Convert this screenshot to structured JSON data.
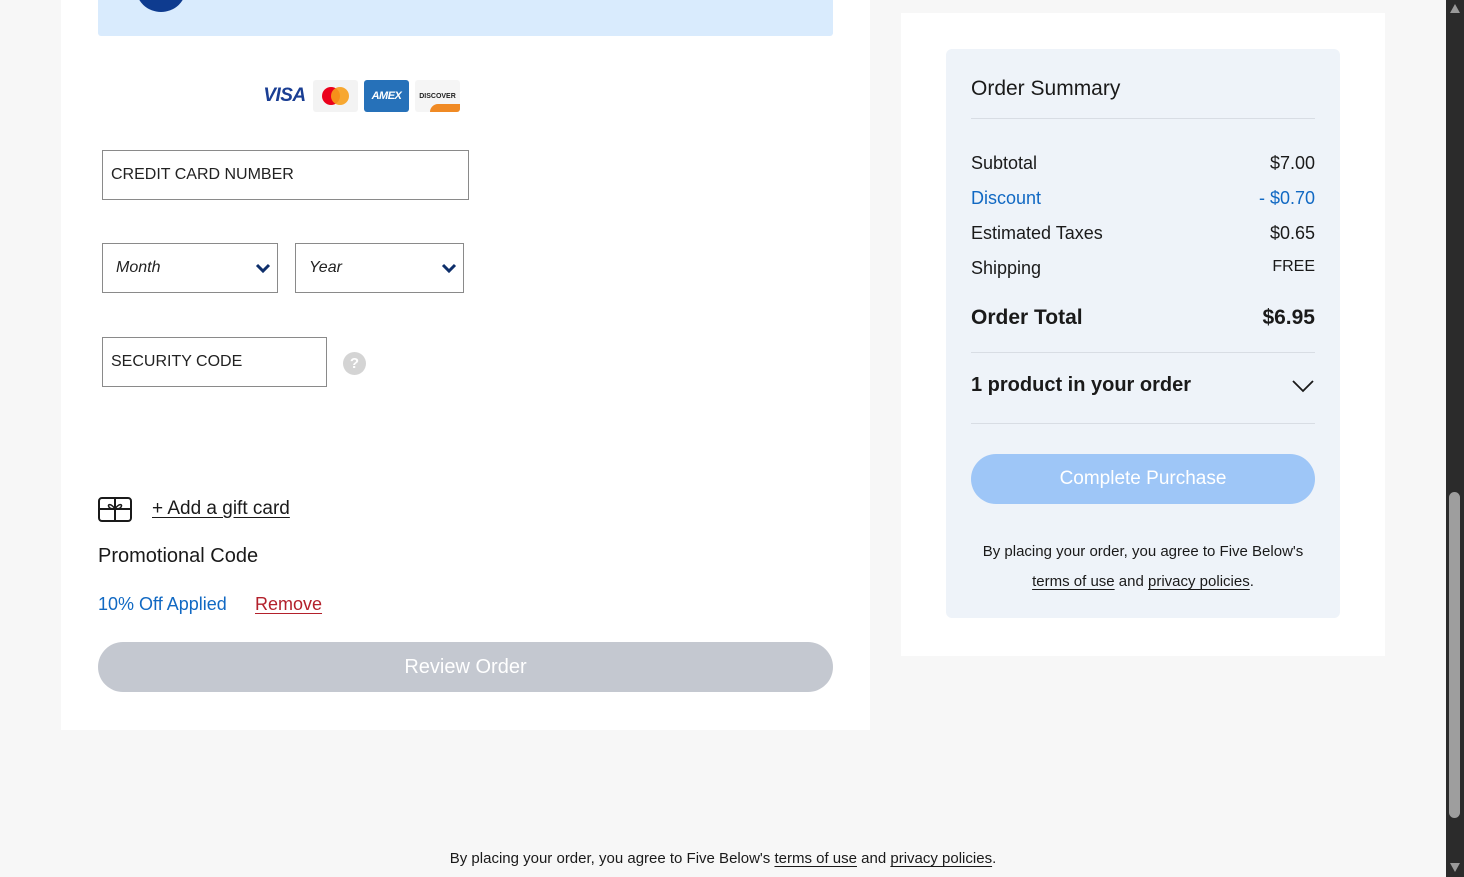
{
  "payment": {
    "card_logos": [
      "VISA",
      "AMEX",
      "DISCOVER"
    ],
    "card_number_placeholder": "CREDIT CARD NUMBER",
    "month_placeholder": "Month",
    "year_placeholder": "Year",
    "security_code_placeholder": "SECURITY CODE",
    "help_glyph": "?"
  },
  "gift_card": {
    "link_label": "+ Add a gift card",
    "icon": "gift-card-icon"
  },
  "promo": {
    "title": "Promotional Code",
    "applied_text": "10% Off Applied",
    "remove_label": "Remove"
  },
  "review_button_label": "Review Order",
  "summary": {
    "title": "Order Summary",
    "subtotal_label": "Subtotal",
    "subtotal_value": "$7.00",
    "discount_label": "Discount",
    "discount_value": "- $0.70",
    "tax_label": "Estimated Taxes",
    "tax_value": "$0.65",
    "shipping_label": "Shipping",
    "shipping_value": "FREE",
    "total_label": "Order Total",
    "total_value": "$6.95",
    "products_label": "1 product in your order",
    "complete_button_label": "Complete Purchase",
    "agree_prefix": "By placing your order, you agree to Five Below's",
    "terms_label": "terms of use",
    "and_text": "and",
    "privacy_label": "privacy policies",
    "period": "."
  },
  "footer": {
    "prefix": "By placing your order, you agree to Five Below's",
    "terms_label": "terms of use",
    "and_text": "and",
    "privacy_label": "privacy policies",
    "period": "."
  },
  "colors": {
    "link_blue": "#1169c3",
    "remove_red": "#b3202b",
    "complete_button": "#9ec6f7",
    "review_button": "#c4c8d0",
    "summary_bg": "#eef3f9"
  }
}
